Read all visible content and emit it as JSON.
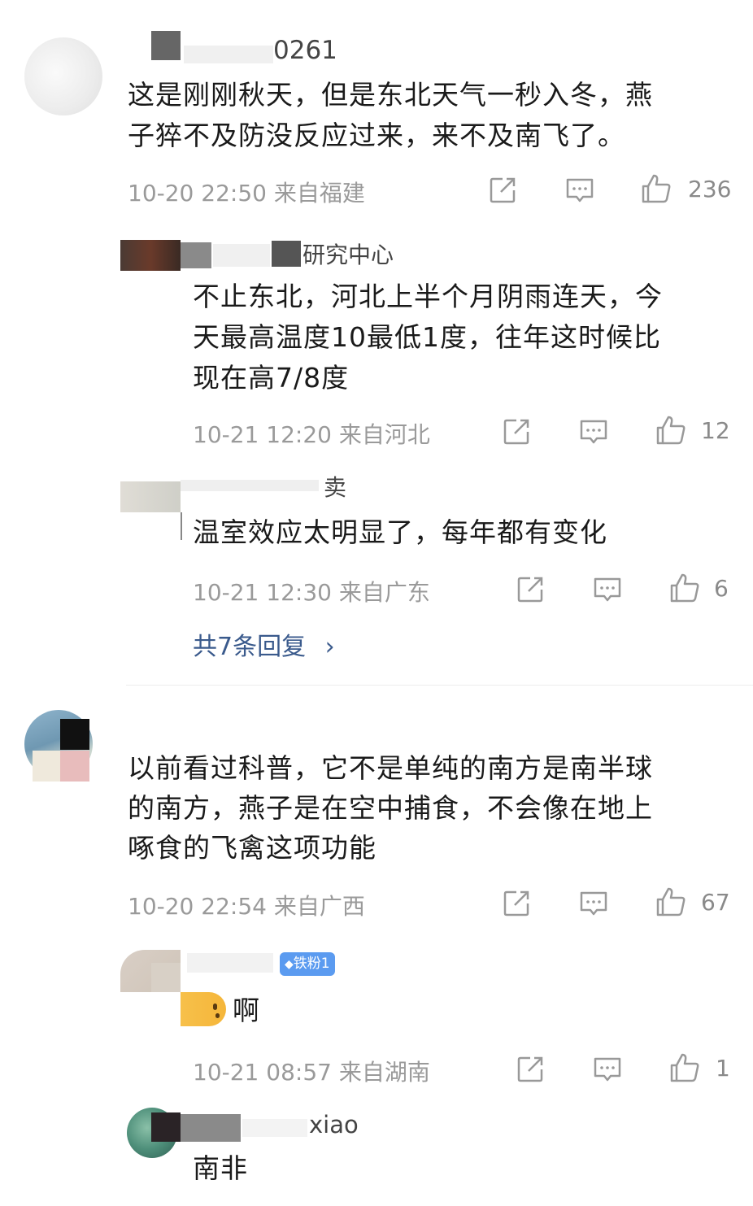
{
  "comments": [
    {
      "name": "0261",
      "text_lines": [
        "这是刚刚秋天，但是东北天气一秒入冬，燕",
        "子猝不及防没反应过来，来不及南飞了。"
      ],
      "meta": "10-20 22:50 来自福建",
      "likes": "236"
    },
    {
      "name": "研究中心",
      "text_lines": [
        "不止东北，河北上半个月阴雨连天，今",
        "天最高温度10最低1度，往年这时候比",
        "现在高7/8度"
      ],
      "meta": "10-21 12:20 来自河北",
      "likes": "12"
    },
    {
      "name": "卖",
      "text_lines": [
        "温室效应太明显了，每年都有变化"
      ],
      "meta": "10-21 12:30 来自广东",
      "likes": "6"
    },
    {
      "more_label": "共7条回复",
      "more_chevron": "›"
    },
    {
      "text_lines": [
        "以前看过科普，它不是单纯的南方是南半球",
        "的南方，燕子是在空中捕食，不会像在地上",
        "啄食的飞禽这项功能"
      ],
      "meta": "10-20 22:54 来自广西",
      "likes": "67"
    },
    {
      "badge": "铁粉1",
      "text": "啊",
      "meta": "10-21 08:57 来自湖南",
      "likes": "1"
    },
    {
      "name": "xiao",
      "text": "南非"
    }
  ],
  "icons": [
    "share-icon",
    "comment-icon",
    "like-icon"
  ]
}
